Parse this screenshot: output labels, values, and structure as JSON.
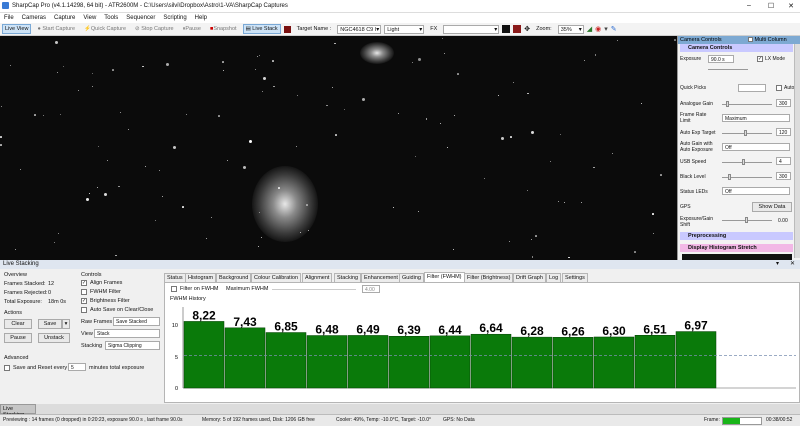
{
  "window": {
    "title": "SharpCap Pro (v4.1.14298, 64 bit) - ATR2600M - C:\\Users\\silvi\\Dropbox\\Astro\\1-VA\\SharpCap Captures"
  },
  "menu": [
    "File",
    "Cameras",
    "Capture",
    "View",
    "Tools",
    "Sequencer",
    "Scripting",
    "Help"
  ],
  "toolbar": {
    "live_view": "Live View",
    "start_capture": "Start Capture",
    "quick_capture": "Quick Capture",
    "stop_capture": "Stop Capture",
    "pause": "Pause",
    "snapshot": "Snapshot",
    "live_stack": "Live Stack",
    "target_name_label": "Target Name :",
    "target_name_value": "NGC4618 C9 I",
    "filter_value": "Light",
    "fx_label": "FX",
    "zoom_label": "Zoom:",
    "zoom_value": "35%"
  },
  "camera_controls": {
    "title": "Camera Controls",
    "multi_column": "Multi Column",
    "sub_header": "Camera Controls",
    "exposure_label": "Exposure",
    "exposure_value": "90.0 s",
    "lx_mode": "LX Mode",
    "quick_picks": "Quick Picks",
    "auto": "Auto",
    "analogue_gain_label": "Analogue Gain",
    "analogue_gain_value": "300",
    "frame_rate_label": "Frame Rate Limit",
    "frame_rate_value": "Maximum",
    "auto_exp_target_label": "Auto Exp Target",
    "auto_exp_target_value": "120",
    "auto_gain_label": "Auto Gain with Auto Exposure",
    "auto_gain_value": "Off",
    "usb_speed_label": "USB Speed",
    "usb_speed_value": "4",
    "black_level_label": "Black Level",
    "black_level_value": "300",
    "status_leds_label": "Status LEDs",
    "status_leds_value": "Off",
    "gps_label": "GPS",
    "show_data": "Show Data",
    "exposure_gain_shift_label": "Exposure/Gain Shift",
    "exposure_gain_shift_value": "0.00",
    "preprocessing": "Preprocessing",
    "display_histogram": "Display Histogram Stretch"
  },
  "live_stacking": {
    "title": "Live Stacking",
    "overview": "Overview",
    "frames_stacked_label": "Frames Stacked:",
    "frames_stacked_value": "12",
    "frames_rejected_label": "Frames Rejected:",
    "frames_rejected_value": "0",
    "total_exposure_label": "Total Exposure:",
    "total_exposure_value": "18m 0s",
    "actions": "Actions",
    "clear": "Clear",
    "save": "Save",
    "pause": "Pause",
    "unstack": "Unstack",
    "advanced": "Advanced",
    "save_reset_label": "Save and Reset every",
    "save_reset_value": "5",
    "save_reset_suffix": "minutes total exposure",
    "controls": "Controls",
    "align_frames": "Align Frames",
    "fwhm_filter": "FWHM Filter",
    "brightness_filter": "Brightness Filter",
    "auto_save": "Auto Save on Clear/Close",
    "raw_frames_label": "Raw Frames",
    "raw_frames_value": "Save Stacked",
    "view_label": "View",
    "view_value": "Stack",
    "stacking_label": "Stacking",
    "stacking_value": "Sigma Clipping"
  },
  "tabs": [
    "Status",
    "Histogram",
    "Background",
    "Colour Calibration",
    "Alignment",
    "Stacking",
    "Enhancement",
    "Guiding",
    "Filter (FWHM)",
    "Filter (Brightness)",
    "Drift Graph",
    "Log",
    "Settings"
  ],
  "fwhm_panel": {
    "filter_on_fwhm": "Filter on FWHM",
    "maximum_fwhm": "Maximum FWHM",
    "maximum_fwhm_value": "4.00",
    "history_title": "FWHM History",
    "y_ticks": [
      "10",
      "5",
      "0"
    ]
  },
  "chart_data": {
    "type": "bar",
    "title": "FWHM History",
    "values": [
      8.22,
      7.43,
      6.85,
      6.48,
      6.49,
      6.39,
      6.44,
      6.64,
      6.28,
      6.26,
      6.3,
      6.51,
      6.97
    ],
    "labels": [
      "8,22",
      "7,43",
      "6,85",
      "6,48",
      "6,49",
      "6,39",
      "6,44",
      "6,64",
      "6,28",
      "6,26",
      "6,30",
      "6,51",
      "6,97"
    ],
    "threshold": 4.0,
    "ylim": [
      0,
      10
    ],
    "bar_color": "#0a7a0a"
  },
  "bottom_tab": "Live Stacking",
  "status": {
    "previewing": "Previewing : 14 frames (0 dropped) in 0:20:23, exposure 90.0 s , last frame 90.0s",
    "memory": "Memory: 5 of 192 frames used, Disk: 1206 GB free",
    "cooler": "Cooler: 49%, Temp: -10.0°C, Target: -10.0°",
    "gps": "GPS: No Data",
    "frame_label": "Frame:",
    "time": "00:38/00:52"
  }
}
